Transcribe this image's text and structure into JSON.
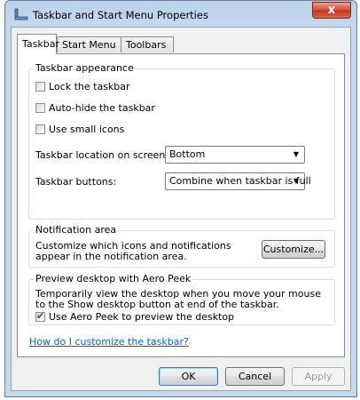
{
  "window": {
    "title": "Taskbar and Start Menu Properties",
    "close_label": "x"
  },
  "tabs": [
    {
      "label": "Taskbar"
    },
    {
      "label": "Start Menu"
    },
    {
      "label": "Toolbars"
    }
  ],
  "appearance": {
    "title": "Taskbar appearance",
    "lock_taskbar": {
      "label": "Lock the taskbar",
      "checked": false
    },
    "auto_hide": {
      "label": "Auto-hide the taskbar",
      "checked": false
    },
    "small_icons": {
      "label": "Use small icons",
      "checked": false
    },
    "location_label": "Taskbar location on screen:",
    "location_value": "Bottom",
    "buttons_label": "Taskbar buttons:",
    "buttons_value": "Combine when taskbar is full"
  },
  "notification": {
    "title": "Notification area",
    "description": "Customize which icons and notifications appear in the notification area.",
    "customize_label": "Customize..."
  },
  "aero_peek": {
    "title": "Preview desktop with Aero Peek",
    "description": "Temporarily view the desktop when you move your mouse to the Show desktop button at end of the taskbar.",
    "checkbox_label": "Use Aero Peek to preview the desktop",
    "checked": true
  },
  "help_link": "How do I customize the taskbar?",
  "buttons": {
    "ok": "OK",
    "cancel": "Cancel",
    "apply": "Apply"
  }
}
